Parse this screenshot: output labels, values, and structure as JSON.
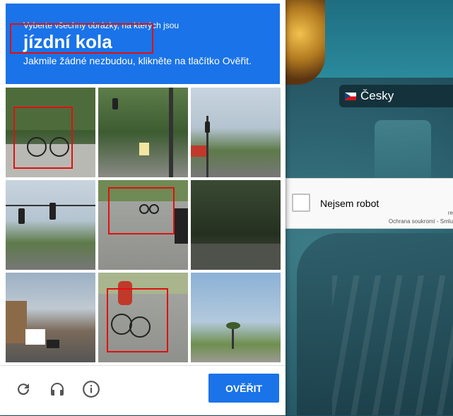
{
  "background": {
    "language_button": {
      "flag_icon": "czech-flag-icon",
      "label": "Česky"
    }
  },
  "anchor": {
    "checkbox_label": "Nejsem robot",
    "brand_fragment": "re",
    "privacy_text": "Ochrana soukromí - Smlu"
  },
  "challenge": {
    "instruction_top": "Vyberte všechny obrázky, na kterých jsou",
    "target_object": "jízdní kola",
    "instruction_bottom": "Jakmile žádné nezbudou, klikněte na tlačítko Ověřit.",
    "accent_color": "#1a73e8",
    "highlight_color": "#e01010",
    "tiles": [
      {
        "content": "bicycle",
        "highlighted": true
      },
      {
        "content": "traffic-light",
        "highlighted": false
      },
      {
        "content": "traffic-light",
        "highlighted": false
      },
      {
        "content": "traffic-light",
        "highlighted": false
      },
      {
        "content": "bicycle",
        "highlighted": true
      },
      {
        "content": "trees",
        "highlighted": false
      },
      {
        "content": "street",
        "highlighted": false
      },
      {
        "content": "bicycle",
        "highlighted": true
      },
      {
        "content": "palm-tree",
        "highlighted": false
      }
    ],
    "footer": {
      "reload_icon": "reload-icon",
      "audio_icon": "headphones-icon",
      "info_icon": "info-icon",
      "verify_label": "OVĚŘIT"
    }
  }
}
